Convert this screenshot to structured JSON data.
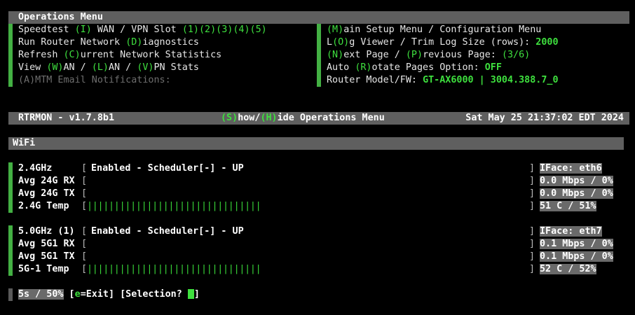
{
  "ops_menu": {
    "title": "Operations Menu",
    "left": [
      {
        "segs": [
          [
            "Speedtest ",
            "t"
          ],
          [
            "(I)",
            "g"
          ],
          [
            " WAN / VPN Slot ",
            "t"
          ],
          [
            "(1)(2)(3)(4)(5)",
            "g"
          ]
        ]
      },
      {
        "segs": [
          [
            "Run Router Network ",
            "t"
          ],
          [
            "(D)",
            "g"
          ],
          [
            "iagnostics",
            "t"
          ]
        ]
      },
      {
        "segs": [
          [
            "Refresh ",
            "t"
          ],
          [
            "(C)",
            "g"
          ],
          [
            "urrent Network Statistics",
            "t"
          ]
        ]
      },
      {
        "segs": [
          [
            "View ",
            "t"
          ],
          [
            "(W)",
            "g"
          ],
          [
            "AN / ",
            "t"
          ],
          [
            "(L)",
            "g"
          ],
          [
            "AN / ",
            "t"
          ],
          [
            "(V)",
            "g"
          ],
          [
            "PN Stats",
            "t"
          ]
        ]
      },
      {
        "segs": [
          [
            "(A)MTM Email Notifications:",
            "d"
          ]
        ]
      }
    ],
    "right": [
      {
        "segs": [
          [
            "(M)",
            "g"
          ],
          [
            "ain Setup Menu / Configuration Menu",
            "t"
          ]
        ]
      },
      {
        "segs": [
          [
            "L",
            "t"
          ],
          [
            "(O)",
            "g"
          ],
          [
            "g Viewer / Trim Log Size (rows): ",
            "t"
          ],
          [
            "2000",
            "gb"
          ]
        ]
      },
      {
        "segs": [
          [
            "(N)",
            "g"
          ],
          [
            "ext Page / ",
            "t"
          ],
          [
            "(P)",
            "g"
          ],
          [
            "revious Page: ",
            "t"
          ],
          [
            "(3/6)",
            "g"
          ]
        ]
      },
      {
        "segs": [
          [
            "Auto ",
            "t"
          ],
          [
            "(R)",
            "g"
          ],
          [
            "otate Pages Option: ",
            "t"
          ],
          [
            "OFF",
            "gb"
          ]
        ]
      },
      {
        "segs": [
          [
            "Router Model/FW: ",
            "t"
          ],
          [
            "GT-AX6000 | 3004.388.7_0",
            "gb"
          ]
        ]
      }
    ]
  },
  "status_bar": {
    "app_version": "RTRMON - v1.7.8b1",
    "show_key": "(S)",
    "show_text": "how/",
    "hide_key": "(H)",
    "hide_text": "ide Operations Menu",
    "datetime": "Sat May 25 21:37:02 EDT 2024"
  },
  "section_title": "WiFi",
  "wifi_24": {
    "rows": [
      {
        "label": "2.4GHz",
        "value": "Enabled - Scheduler[-] - UP",
        "right": "IFace: eth6"
      },
      {
        "label": "Avg 24G RX",
        "value": "",
        "right": "0.0 Mbps / 0%"
      },
      {
        "label": "Avg 24G TX",
        "value": "",
        "right": "0.0 Mbps / 0%"
      },
      {
        "label": "2.4G Temp",
        "value": "",
        "right": "51 C / 51%"
      }
    ],
    "temp_fraction": 0.51
  },
  "wifi_5": {
    "rows": [
      {
        "label": "5.0GHz (1)",
        "value": "Enabled - Scheduler[-] - UP",
        "right": "IFace: eth7"
      },
      {
        "label": "Avg 5G1 RX",
        "value": "",
        "right": "0.1 Mbps / 0%"
      },
      {
        "label": "Avg 5G1 TX",
        "value": "",
        "right": "0.1 Mbps / 0%"
      },
      {
        "label": "5G-1 Temp",
        "value": "",
        "right": "52 C / 52%"
      }
    ],
    "temp_fraction": 0.52
  },
  "prompt": {
    "timer": "5s / 50%",
    "open": " [",
    "exit_key": "e",
    "exit_text": "=Exit] [Selection? ",
    "close": "]"
  }
}
